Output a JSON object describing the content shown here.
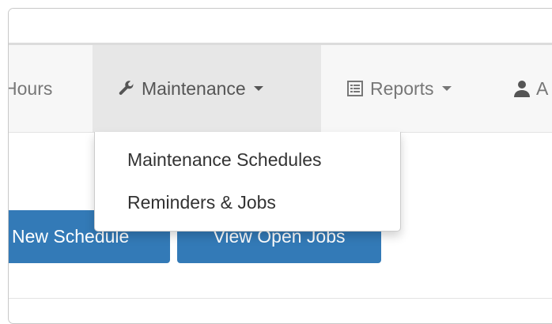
{
  "navbar": {
    "items": [
      {
        "label": "Hours",
        "icon": "clock-icon"
      },
      {
        "label": "Maintenance",
        "icon": "wrench-icon",
        "active": true
      },
      {
        "label": "Reports",
        "icon": "report-list-icon"
      },
      {
        "label": "A",
        "icon": "user-icon"
      }
    ]
  },
  "dropdown": {
    "items": [
      {
        "label": "Maintenance Schedules"
      },
      {
        "label": "Reminders & Jobs"
      }
    ]
  },
  "actions": {
    "new_schedule_label": "New Schedule",
    "view_open_jobs_label": "View Open Jobs"
  },
  "colors": {
    "primary_button": "#337ab7",
    "navbar_bg": "#f7f7f7",
    "active_nav_bg": "#e7e7e7",
    "nav_text": "#777777"
  }
}
